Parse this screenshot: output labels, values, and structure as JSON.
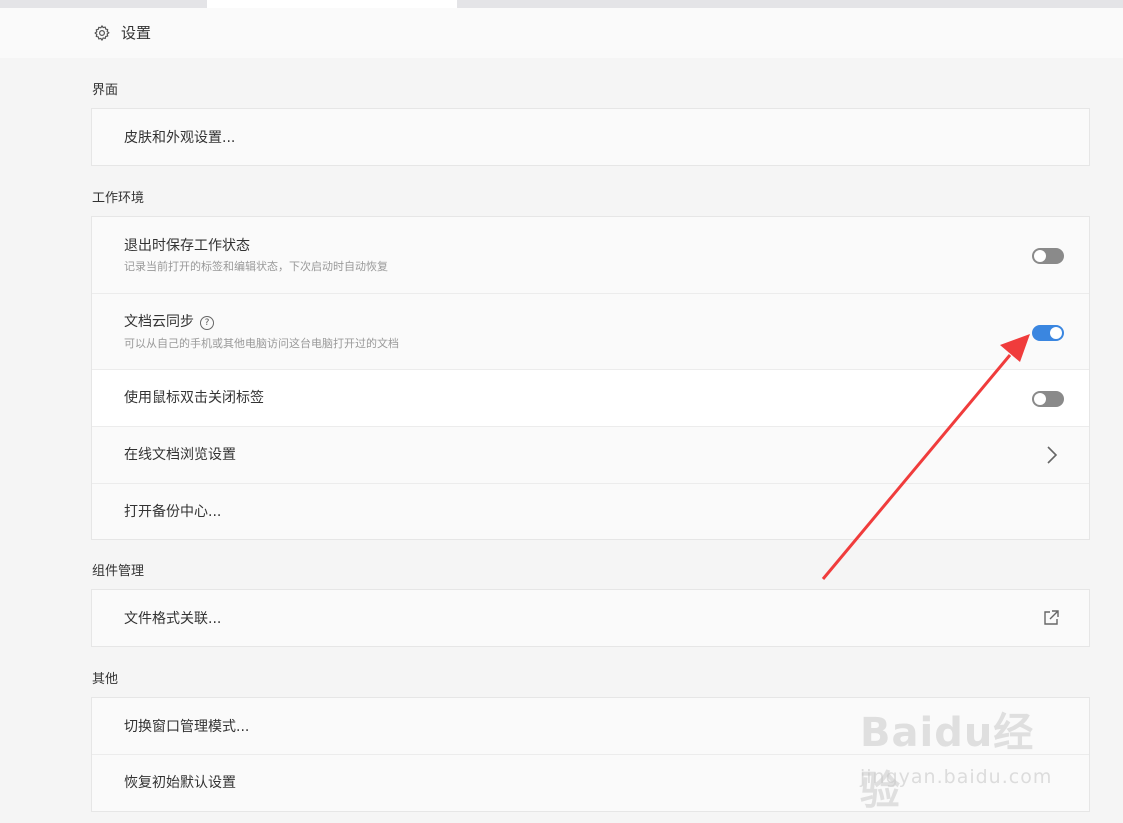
{
  "header": {
    "title": "设置",
    "icon": "gear-icon"
  },
  "sections": {
    "interface": {
      "label": "界面",
      "items": [
        {
          "label": "皮肤和外观设置..."
        }
      ]
    },
    "workspace": {
      "label": "工作环境",
      "items": [
        {
          "label": "退出时保存工作状态",
          "desc": "记录当前打开的标签和编辑状态，下次启动时自动恢复",
          "toggle": "off"
        },
        {
          "label": "文档云同步",
          "desc": "可以从自己的手机或其他电脑访问这台电脑打开过的文档",
          "help": "?",
          "toggle": "on"
        },
        {
          "label": "使用鼠标双击关闭标签",
          "toggle": "off"
        },
        {
          "label": "在线文档浏览设置",
          "icon": "chevron-right-icon"
        },
        {
          "label": "打开备份中心..."
        }
      ]
    },
    "components": {
      "label": "组件管理",
      "items": [
        {
          "label": "文件格式关联...",
          "icon": "external-link-icon"
        }
      ]
    },
    "other": {
      "label": "其他",
      "items": [
        {
          "label": "切换窗口管理模式..."
        },
        {
          "label": "恢复初始默认设置"
        }
      ]
    }
  },
  "colors": {
    "toggle_on": "#3a86e0",
    "toggle_off": "#8a8a8a",
    "annotation_arrow": "#f03c3c"
  },
  "watermark": {
    "logo": "Baidu经验",
    "url": "jingyan.baidu.com"
  }
}
